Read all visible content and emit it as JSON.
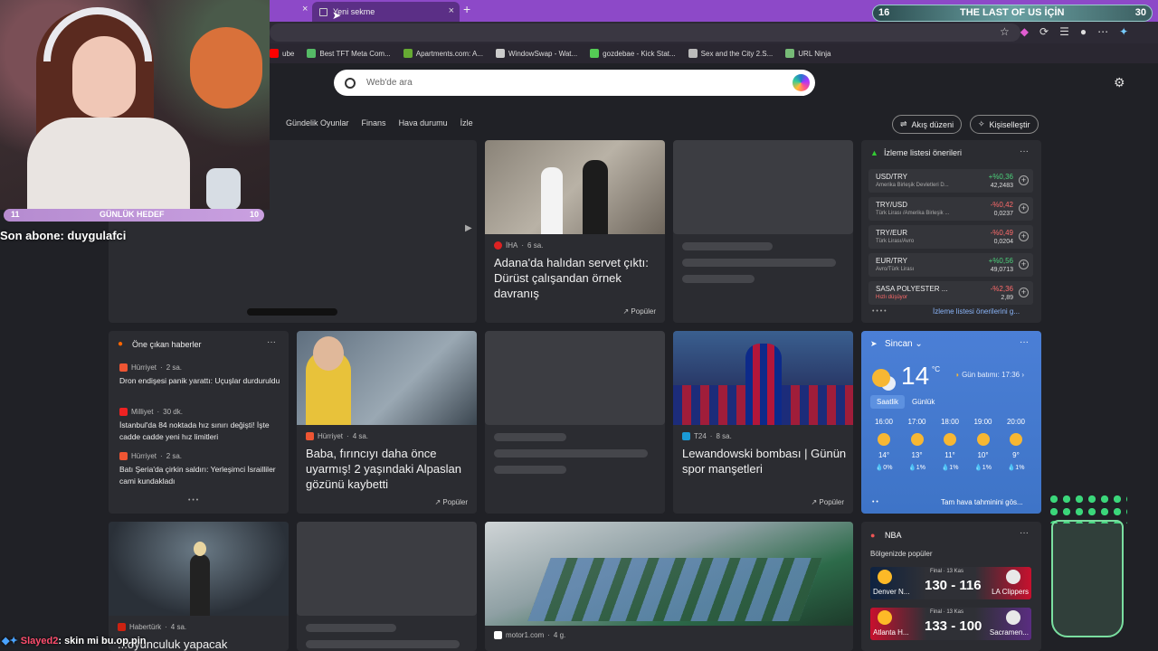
{
  "browser": {
    "active_tab_label": "Yeni sekme",
    "tab_close_glyph": "×",
    "new_tab_glyph": "+",
    "window_controls": "— ▢ ✕",
    "bookmarks": [
      {
        "label": "ube",
        "icon": "youtube-icon"
      },
      {
        "label": "Best TFT Meta Com...",
        "icon": "tft-icon"
      },
      {
        "label": "Apartments.com: A...",
        "icon": "apartments-icon"
      },
      {
        "label": "WindowSwap - Wat...",
        "icon": "window-icon"
      },
      {
        "label": "gozdebae - Kick Stat...",
        "icon": "kick-icon"
      },
      {
        "label": "Sex and the City 2.S...",
        "icon": "globe-icon"
      },
      {
        "label": "URL Ninja",
        "icon": "ninja-icon"
      }
    ]
  },
  "search": {
    "placeholder": "Web'de ara"
  },
  "nav": {
    "tabs": [
      "Gündelik Oyunlar",
      "Finans",
      "Hava durumu",
      "İzle"
    ],
    "layout_label": "Akış düzeni",
    "personalize_label": "Kişiselleştir"
  },
  "cards": {
    "top_story": {
      "source": "İHA",
      "age": "6 sa.",
      "headline": "Adana'da halıdan servet çıktı: Dürüst çalışandan örnek davranış",
      "badge": "Popüler"
    },
    "highlights": {
      "title": "Öne çıkan haberler",
      "more": "···",
      "items": [
        {
          "source": "Hürriyet",
          "age": "2 sa.",
          "text": "Dron endişesi panik yarattı: Uçuşlar durduruldu"
        },
        {
          "source": "Milliyet",
          "age": "30 dk.",
          "text": "İstanbul'da 84 noktada hız sınırı değişti! İşte cadde cadde yeni hız limitleri"
        },
        {
          "source": "Hürriyet",
          "age": "2 sa.",
          "text": "Batı Şeria'da çirkin saldırı: Yerleşimci İsrailliler cami kundakladı"
        }
      ]
    },
    "baby_story": {
      "source": "Hürriyet",
      "age": "4 sa.",
      "headline": "Baba, fırıncıyı daha önce uyarmış! 2 yaşındaki Alpaslan gözünü kaybetti",
      "badge": "Popüler"
    },
    "sport_story": {
      "source": "T24",
      "age": "8 sa.",
      "headline": "Lewandowski bombası | Günün spor manşetleri",
      "badge": "Popüler"
    },
    "bottom_left": {
      "source": "Habertürk",
      "age": "4 sa.",
      "headline": "...oyunculuk yapacak"
    },
    "bottom_mid": {
      "source": "motor1.com",
      "age": "4 g."
    }
  },
  "watchlist": {
    "title": "İzleme listesi önerileri",
    "more": "···",
    "footer": "İzleme listesi önerilerini g...",
    "rows": [
      {
        "symbol": "USD/TRY",
        "name": "Amerika Birleşik Devletleri D...",
        "change": "+%0,36",
        "price": "42,2483",
        "up": true
      },
      {
        "symbol": "TRY/USD",
        "name": "Türk Lirası /Amerika Birleşik ...",
        "change": "-%0,42",
        "price": "0,0237",
        "up": false
      },
      {
        "symbol": "TRY/EUR",
        "name": "Türk Lirası/Avro",
        "change": "-%0,49",
        "price": "0,0204",
        "up": false
      },
      {
        "symbol": "EUR/TRY",
        "name": "Avro/Türk Lirası",
        "change": "+%0,56",
        "price": "49,0713",
        "up": true
      },
      {
        "symbol": "SASA POLYESTER ...",
        "name": "Hızlı düşüyor",
        "change": "-%2,36",
        "price": "2,89",
        "up": false
      }
    ]
  },
  "weather": {
    "location": "Sincan",
    "temp": "14",
    "unit": "°C",
    "sunset": "Gün batımı: 17:36",
    "tabs": [
      "Saatlik",
      "Günlük"
    ],
    "hours": [
      {
        "time": "16:00",
        "temp": "14°",
        "rain": "0%"
      },
      {
        "time": "17:00",
        "temp": "13°",
        "rain": "1%"
      },
      {
        "time": "18:00",
        "temp": "11°",
        "rain": "1%"
      },
      {
        "time": "19:00",
        "temp": "10°",
        "rain": "1%"
      },
      {
        "time": "20:00",
        "temp": "9°",
        "rain": "1%"
      }
    ],
    "footer": "Tam hava tahminini gös..."
  },
  "nba": {
    "title": "NBA",
    "subtitle": "Bölgenizde popüler",
    "games": [
      {
        "home": "Denver N...",
        "away": "LA Clippers",
        "score": "130 - 116",
        "status": "Final · 13 Kas",
        "home_color": "#0e2240",
        "away_color": "#c8102e"
      },
      {
        "home": "Atlanta H...",
        "away": "Sacramen...",
        "score": "133 - 100",
        "status": "Final · 13 Kas",
        "home_color": "#c8102e",
        "away_color": "#5a2d81"
      }
    ]
  },
  "stream": {
    "goal_left": "11",
    "goal_title": "GÜNLÜK HEDEF",
    "goal_right": "10",
    "last_sub": "Son abone: duygulafci",
    "sub_goal_left": "16",
    "sub_goal_title": "THE LAST OF US İÇİN",
    "sub_goal_right": "30",
    "chat_user": "Slayed2",
    "chat_text": ": skin mi bu.op.pin"
  }
}
